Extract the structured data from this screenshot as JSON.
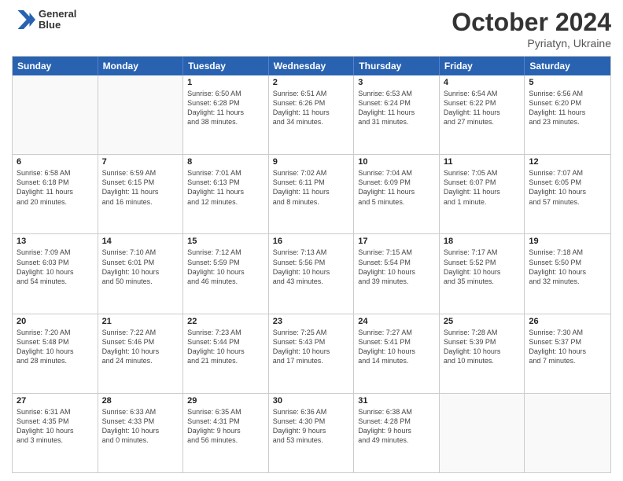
{
  "header": {
    "logo_line1": "General",
    "logo_line2": "Blue",
    "month_title": "October 2024",
    "subtitle": "Pyriatyn, Ukraine"
  },
  "day_headers": [
    "Sunday",
    "Monday",
    "Tuesday",
    "Wednesday",
    "Thursday",
    "Friday",
    "Saturday"
  ],
  "weeks": [
    [
      {
        "day": "",
        "info": ""
      },
      {
        "day": "",
        "info": ""
      },
      {
        "day": "1",
        "info": "Sunrise: 6:50 AM\nSunset: 6:28 PM\nDaylight: 11 hours\nand 38 minutes."
      },
      {
        "day": "2",
        "info": "Sunrise: 6:51 AM\nSunset: 6:26 PM\nDaylight: 11 hours\nand 34 minutes."
      },
      {
        "day": "3",
        "info": "Sunrise: 6:53 AM\nSunset: 6:24 PM\nDaylight: 11 hours\nand 31 minutes."
      },
      {
        "day": "4",
        "info": "Sunrise: 6:54 AM\nSunset: 6:22 PM\nDaylight: 11 hours\nand 27 minutes."
      },
      {
        "day": "5",
        "info": "Sunrise: 6:56 AM\nSunset: 6:20 PM\nDaylight: 11 hours\nand 23 minutes."
      }
    ],
    [
      {
        "day": "6",
        "info": "Sunrise: 6:58 AM\nSunset: 6:18 PM\nDaylight: 11 hours\nand 20 minutes."
      },
      {
        "day": "7",
        "info": "Sunrise: 6:59 AM\nSunset: 6:15 PM\nDaylight: 11 hours\nand 16 minutes."
      },
      {
        "day": "8",
        "info": "Sunrise: 7:01 AM\nSunset: 6:13 PM\nDaylight: 11 hours\nand 12 minutes."
      },
      {
        "day": "9",
        "info": "Sunrise: 7:02 AM\nSunset: 6:11 PM\nDaylight: 11 hours\nand 8 minutes."
      },
      {
        "day": "10",
        "info": "Sunrise: 7:04 AM\nSunset: 6:09 PM\nDaylight: 11 hours\nand 5 minutes."
      },
      {
        "day": "11",
        "info": "Sunrise: 7:05 AM\nSunset: 6:07 PM\nDaylight: 11 hours\nand 1 minute."
      },
      {
        "day": "12",
        "info": "Sunrise: 7:07 AM\nSunset: 6:05 PM\nDaylight: 10 hours\nand 57 minutes."
      }
    ],
    [
      {
        "day": "13",
        "info": "Sunrise: 7:09 AM\nSunset: 6:03 PM\nDaylight: 10 hours\nand 54 minutes."
      },
      {
        "day": "14",
        "info": "Sunrise: 7:10 AM\nSunset: 6:01 PM\nDaylight: 10 hours\nand 50 minutes."
      },
      {
        "day": "15",
        "info": "Sunrise: 7:12 AM\nSunset: 5:59 PM\nDaylight: 10 hours\nand 46 minutes."
      },
      {
        "day": "16",
        "info": "Sunrise: 7:13 AM\nSunset: 5:56 PM\nDaylight: 10 hours\nand 43 minutes."
      },
      {
        "day": "17",
        "info": "Sunrise: 7:15 AM\nSunset: 5:54 PM\nDaylight: 10 hours\nand 39 minutes."
      },
      {
        "day": "18",
        "info": "Sunrise: 7:17 AM\nSunset: 5:52 PM\nDaylight: 10 hours\nand 35 minutes."
      },
      {
        "day": "19",
        "info": "Sunrise: 7:18 AM\nSunset: 5:50 PM\nDaylight: 10 hours\nand 32 minutes."
      }
    ],
    [
      {
        "day": "20",
        "info": "Sunrise: 7:20 AM\nSunset: 5:48 PM\nDaylight: 10 hours\nand 28 minutes."
      },
      {
        "day": "21",
        "info": "Sunrise: 7:22 AM\nSunset: 5:46 PM\nDaylight: 10 hours\nand 24 minutes."
      },
      {
        "day": "22",
        "info": "Sunrise: 7:23 AM\nSunset: 5:44 PM\nDaylight: 10 hours\nand 21 minutes."
      },
      {
        "day": "23",
        "info": "Sunrise: 7:25 AM\nSunset: 5:43 PM\nDaylight: 10 hours\nand 17 minutes."
      },
      {
        "day": "24",
        "info": "Sunrise: 7:27 AM\nSunset: 5:41 PM\nDaylight: 10 hours\nand 14 minutes."
      },
      {
        "day": "25",
        "info": "Sunrise: 7:28 AM\nSunset: 5:39 PM\nDaylight: 10 hours\nand 10 minutes."
      },
      {
        "day": "26",
        "info": "Sunrise: 7:30 AM\nSunset: 5:37 PM\nDaylight: 10 hours\nand 7 minutes."
      }
    ],
    [
      {
        "day": "27",
        "info": "Sunrise: 6:31 AM\nSunset: 4:35 PM\nDaylight: 10 hours\nand 3 minutes."
      },
      {
        "day": "28",
        "info": "Sunrise: 6:33 AM\nSunset: 4:33 PM\nDaylight: 10 hours\nand 0 minutes."
      },
      {
        "day": "29",
        "info": "Sunrise: 6:35 AM\nSunset: 4:31 PM\nDaylight: 9 hours\nand 56 minutes."
      },
      {
        "day": "30",
        "info": "Sunrise: 6:36 AM\nSunset: 4:30 PM\nDaylight: 9 hours\nand 53 minutes."
      },
      {
        "day": "31",
        "info": "Sunrise: 6:38 AM\nSunset: 4:28 PM\nDaylight: 9 hours\nand 49 minutes."
      },
      {
        "day": "",
        "info": ""
      },
      {
        "day": "",
        "info": ""
      }
    ]
  ]
}
